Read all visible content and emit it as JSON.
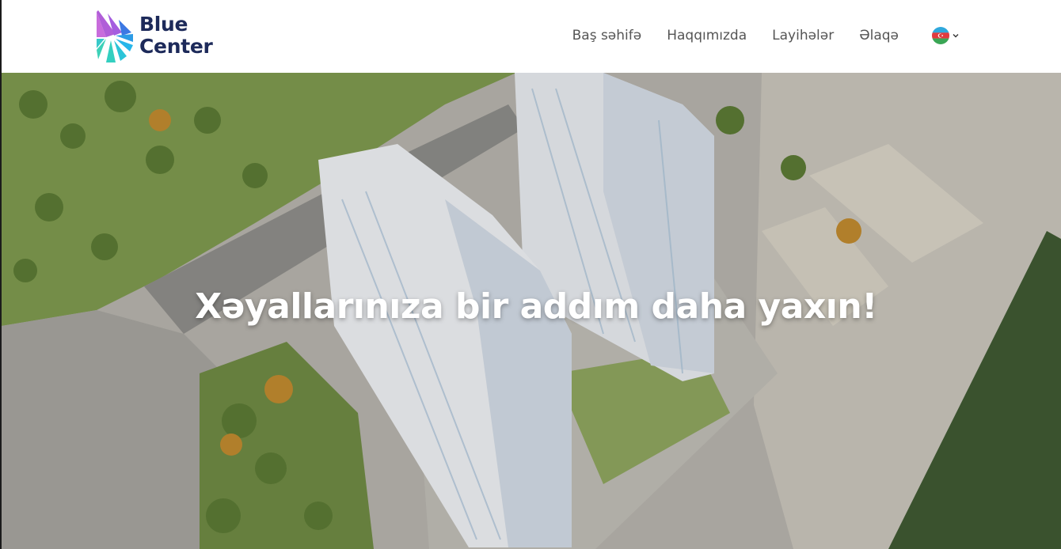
{
  "brand": {
    "line1": "Blue",
    "line2": "Center",
    "text_color": "#1d2a5a",
    "logo_colors": [
      "#b760d6",
      "#4a6fe0",
      "#2bb6e8",
      "#35d0c2"
    ]
  },
  "nav": {
    "items": [
      {
        "label": "Baş səhifə"
      },
      {
        "label": "Haqqımızda"
      },
      {
        "label": "Layihələr"
      },
      {
        "label": "Əlaqə"
      }
    ],
    "language": {
      "icon": "azerbaijan-flag-icon",
      "dropdown_icon": "chevron-down-icon"
    }
  },
  "hero": {
    "title": "Xəyallarınıza bir addım daha yaxın!",
    "image": "aerial-rendering-residential-towers"
  },
  "colors": {
    "nav_text": "#555555",
    "hero_text": "#ffffff"
  }
}
